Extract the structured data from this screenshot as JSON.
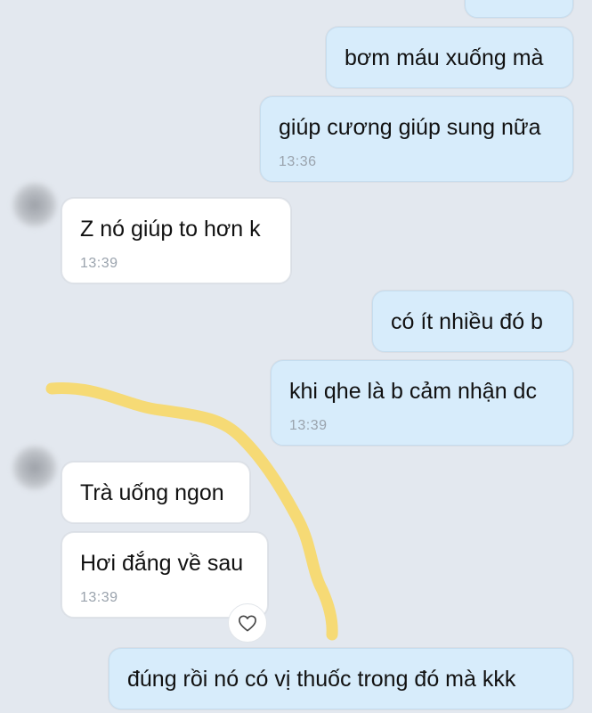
{
  "messages": [
    {
      "text": "bơm máu xuống mà"
    },
    {
      "text": "giúp cương giúp sung nữa",
      "time": "13:36"
    },
    {
      "text": "Z nó giúp to hơn k",
      "time": "13:39"
    },
    {
      "text": "có ít nhiều đó b"
    },
    {
      "text": "khi qhe là b cảm nhận dc",
      "time": "13:39"
    },
    {
      "text": "Trà uống ngon"
    },
    {
      "text": "Hơi đắng về sau",
      "time": "13:39"
    },
    {
      "text": "đúng rồi nó có vị thuốc trong đó mà kkk"
    }
  ],
  "colors": {
    "background": "#e3e8ef",
    "outgoing_bubble": "#d7ecfb",
    "incoming_bubble": "#ffffff",
    "highlight_stroke": "#f7d86a"
  },
  "icons": {
    "reaction": "heart-outline-icon"
  }
}
